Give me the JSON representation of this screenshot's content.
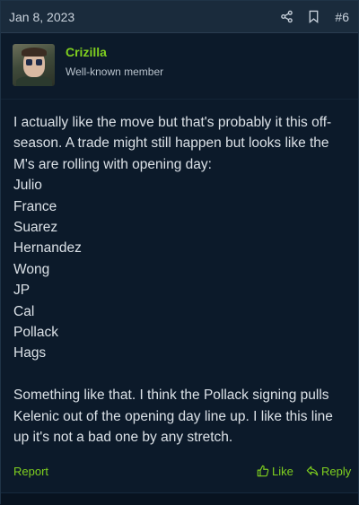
{
  "post": {
    "date": "Jan 8, 2023",
    "number": "#6",
    "icons": {
      "share": "share-icon",
      "bookmark": "bookmark-icon"
    }
  },
  "user": {
    "name": "Crizilla",
    "title": "Well-known member"
  },
  "body": {
    "lines": [
      "I actually like the move but that's probably it this off-",
      "season. A trade might still happen but looks like the",
      "M's are rolling with opening day:",
      "Julio",
      "France",
      "Suarez",
      "Hernandez",
      "Wong",
      "JP",
      "Cal",
      "Pollack",
      "Hags",
      "",
      "Something like that. I think the Pollack signing pulls",
      "Kelenic out of the opening day line up. I like this line",
      "up it's not a bad one by any stretch."
    ]
  },
  "actions": {
    "report": "Report",
    "like": "Like",
    "reply": "Reply"
  },
  "colors": {
    "accent": "#7fcf1f",
    "background": "#0c1a2a",
    "header": "#1a2b3c"
  }
}
